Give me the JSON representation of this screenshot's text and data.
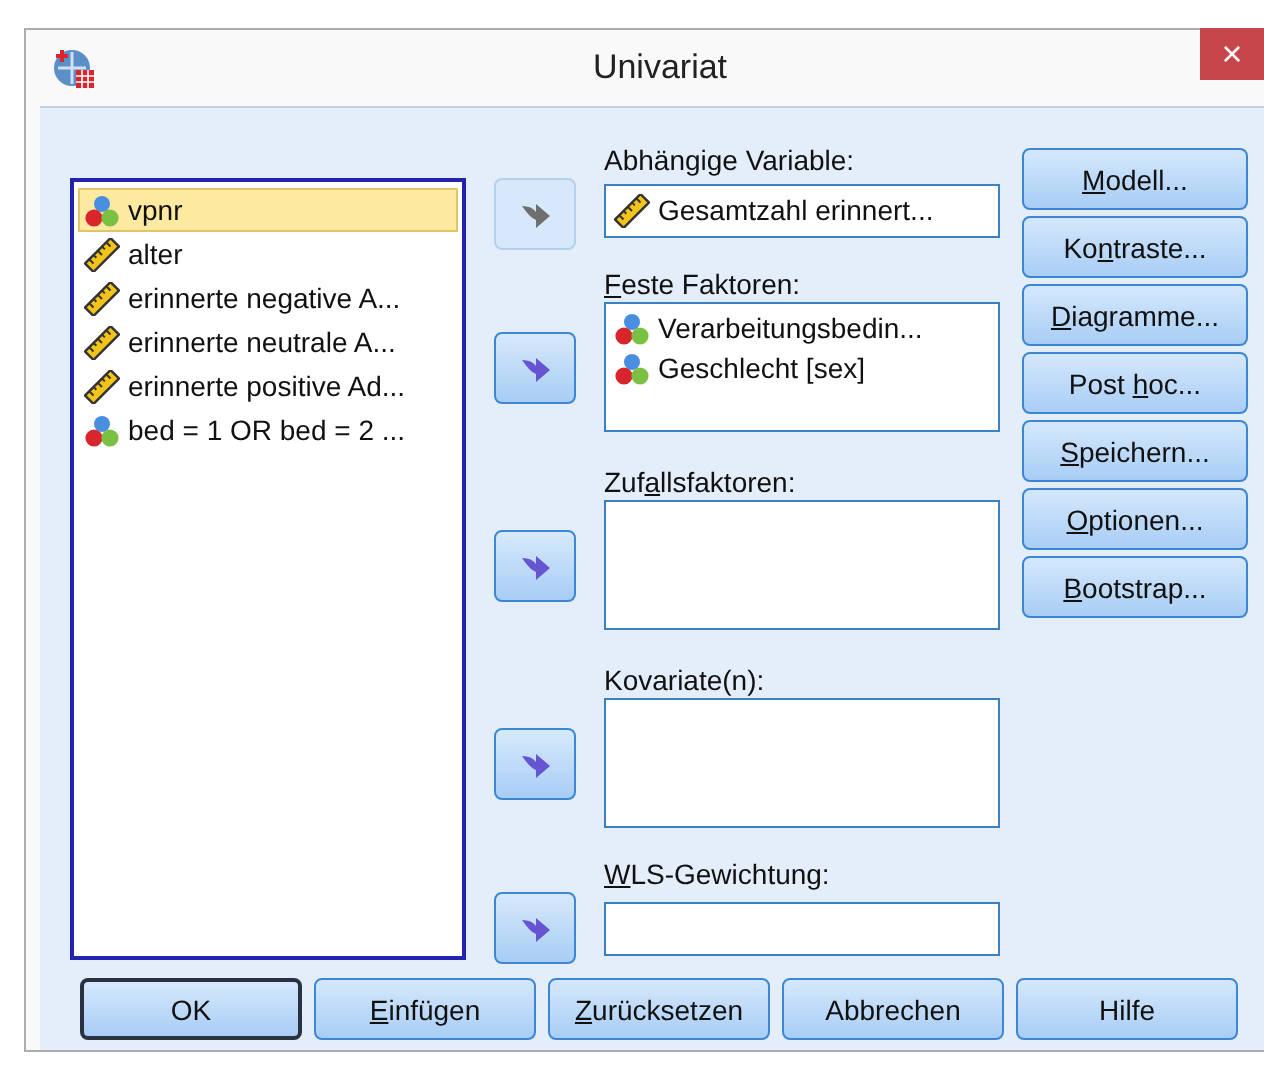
{
  "window": {
    "title": "Univariat",
    "close": "×"
  },
  "variables": [
    {
      "name": "vpnr",
      "kind": "nominal",
      "selected": true
    },
    {
      "name": "alter",
      "kind": "scale",
      "selected": false
    },
    {
      "name": "erinnerte negative A...",
      "kind": "scale",
      "selected": false
    },
    {
      "name": "erinnerte neutrale A...",
      "kind": "scale",
      "selected": false
    },
    {
      "name": "erinnerte positive Ad...",
      "kind": "scale",
      "selected": false
    },
    {
      "name": "bed = 1 OR  bed = 2 ...",
      "kind": "nominal",
      "selected": false
    }
  ],
  "targets": [
    {
      "label": "Abhängige Variable:",
      "arrow_disabled": true,
      "kind": "single",
      "items": [
        {
          "name": "Gesamtzahl erinnert...",
          "kind": "scale"
        }
      ]
    },
    {
      "label": {
        "key": "F",
        "post": "este Faktoren:"
      },
      "arrow_disabled": false,
      "kind": "list",
      "items": [
        {
          "name": "Verarbeitungsbedin...",
          "kind": "nominal"
        },
        {
          "name": "Geschlecht [sex]",
          "kind": "nominal"
        }
      ]
    },
    {
      "label": {
        "pre": "Zuf",
        "key": "a",
        "post": "llsfaktoren:"
      },
      "arrow_disabled": false,
      "kind": "list"
    },
    {
      "label": "Kovariate(n):",
      "arrow_disabled": false,
      "kind": "list"
    },
    {
      "label": {
        "key": "W",
        "post": "LS-Gewichtung:"
      },
      "arrow_disabled": false,
      "kind": "single"
    }
  ],
  "side_buttons": [
    {
      "label": {
        "key": "M",
        "post": "odell..."
      }
    },
    {
      "label": {
        "pre": "Ko",
        "key": "n",
        "post": "traste..."
      }
    },
    {
      "label": {
        "key": "D",
        "post": "iagramme..."
      }
    },
    {
      "label": {
        "pre": "Post ",
        "key": "h",
        "post": "oc..."
      }
    },
    {
      "label": {
        "key": "S",
        "post": "peichern..."
      }
    },
    {
      "label": {
        "key": "O",
        "post": "ptionen..."
      }
    },
    {
      "label": {
        "key": "B",
        "post": "ootstrap..."
      }
    }
  ],
  "bottom_buttons": [
    {
      "label": "OK",
      "default": true
    },
    {
      "label": {
        "key": "E",
        "post": "infügen"
      },
      "default": false
    },
    {
      "label": {
        "key": "Z",
        "post": "urücksetzen"
      },
      "default": false
    },
    {
      "label": "Abbrechen",
      "default": false
    },
    {
      "label": "Hilfe",
      "default": false
    }
  ]
}
